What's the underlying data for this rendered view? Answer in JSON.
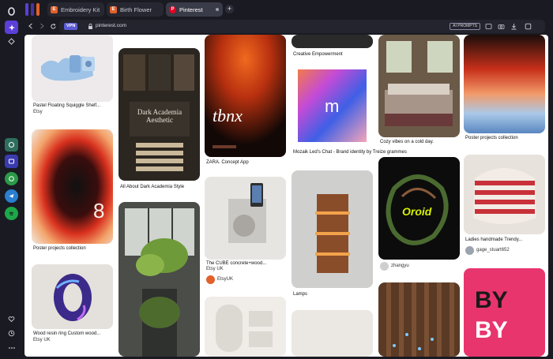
{
  "browser": {
    "tabs": [
      {
        "label": "Embroidery Kit",
        "favicon": "E"
      },
      {
        "label": "Birth Flower",
        "favicon": "E"
      },
      {
        "label": "Pinterest",
        "favicon": "P"
      }
    ],
    "new_tab_label": "+",
    "vpn_label": "VPN",
    "url": "pinterest.com",
    "ai_prompts_label": "AI PROMPTS"
  },
  "pins": [
    {
      "title": "Pastel Floating Squiggle Shelf...",
      "subtitle": "Etsy"
    },
    {
      "title": "All About Dark Academia Style",
      "subtitle": ""
    },
    {
      "title": "ZARA. Concept App",
      "subtitle": ""
    },
    {
      "title": "Creative Empowerment",
      "subtitle": ""
    },
    {
      "title": "Cozy vibes on a cold day.",
      "subtitle": ""
    },
    {
      "title": "Poster projects collection",
      "subtitle": ""
    },
    {
      "title": "Mozaik Led's Chat - Brand identity by Treize grammes",
      "subtitle": ""
    },
    {
      "title": "Poster projects collection",
      "subtitle": ""
    },
    {
      "title": "The CUBE concrete+wood...",
      "subtitle": "Etsy UK",
      "user": "EtsyUK"
    },
    {
      "title": "Lamps",
      "subtitle": ""
    },
    {
      "title": "Ladies handmade Trendy...",
      "subtitle": "",
      "user": "gage_stuart652"
    },
    {
      "title": "Wood resin ring Custom wood...",
      "subtitle": "Etsy UK"
    },
    {
      "title": "",
      "subtitle": "",
      "user": "zhangyu"
    }
  ],
  "pin_art": {
    "dark_academia_heading": "Dark Academia Aesthetic",
    "tbnx": "tbnx",
    "mozaik_logo": "m",
    "oroid": "Oroid",
    "by": "BY",
    "poster_eight": "8"
  }
}
